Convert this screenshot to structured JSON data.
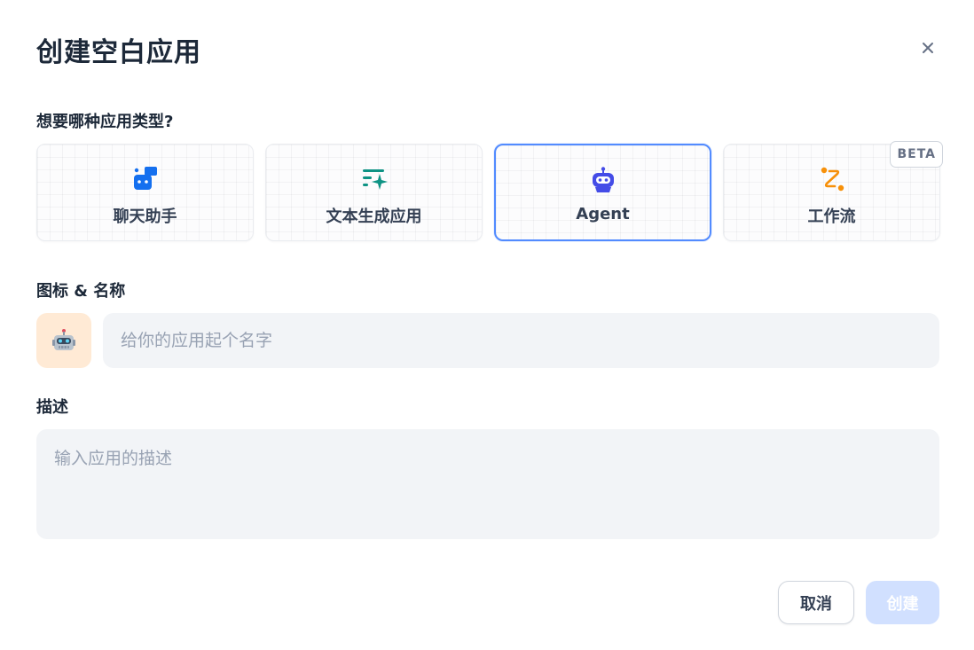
{
  "dialog": {
    "title": "创建空白应用"
  },
  "app_type": {
    "label": "想要哪种应用类型?",
    "options": [
      {
        "label": "聊天助手",
        "icon": "chat-bubble-icon",
        "color": "#1570ef"
      },
      {
        "label": "文本生成应用",
        "icon": "text-sparkle-icon",
        "color": "#0e9384"
      },
      {
        "label": "Agent",
        "icon": "robot-icon",
        "color": "#444ce7"
      },
      {
        "label": "工作流",
        "icon": "workflow-route-icon",
        "color": "#f79009",
        "badge": "BETA"
      }
    ],
    "selected": "Agent"
  },
  "name_section": {
    "label": "图标 & 名称",
    "icon_emoji": "🤖",
    "icon_bg": "#ffead5",
    "name_placeholder": "给你的应用起个名字",
    "name_value": ""
  },
  "description_section": {
    "label": "描述",
    "placeholder": "输入应用的描述",
    "value": ""
  },
  "footer": {
    "cancel_label": "取消",
    "create_label": "创建"
  },
  "colors": {
    "selected_border": "#528bff",
    "create_button_disabled": "#d1e0ff"
  }
}
